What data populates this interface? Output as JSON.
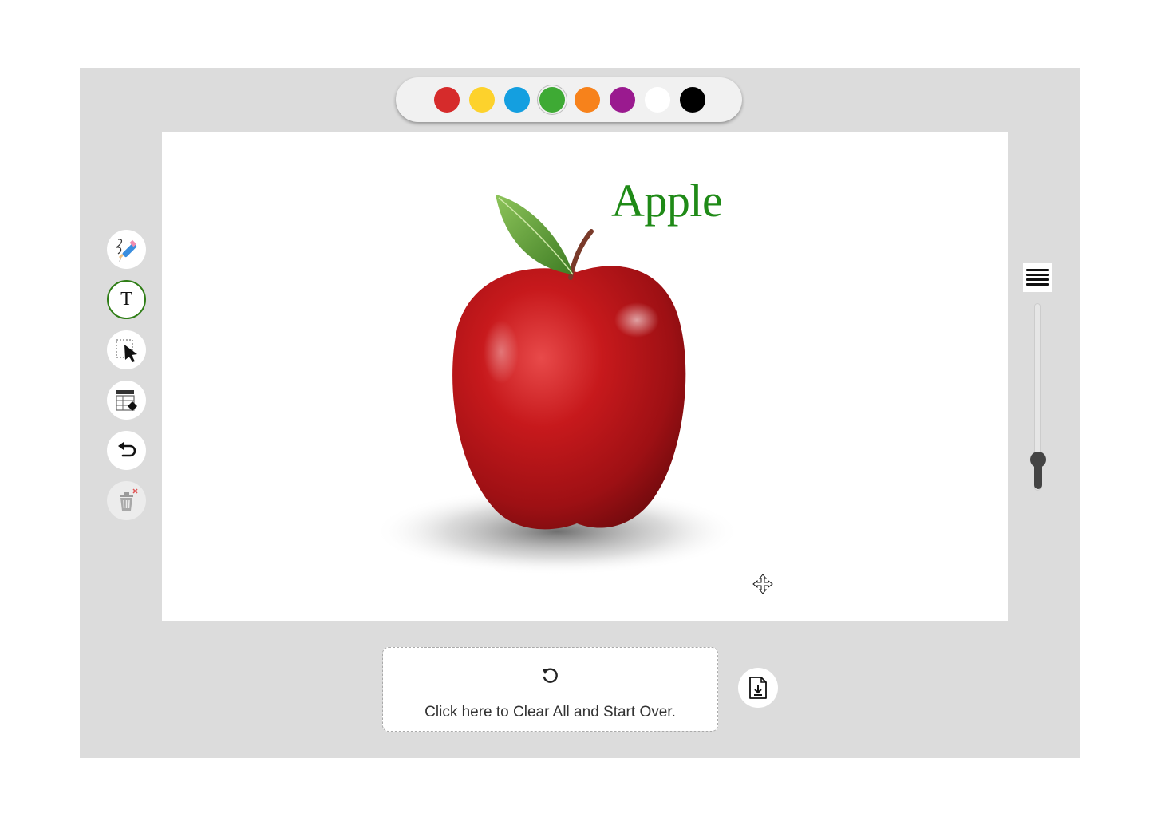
{
  "palette": {
    "colors": [
      "#d62b2b",
      "#fdd22c",
      "#149fe0",
      "#3eaa34",
      "#f7821b",
      "#9a1a8f",
      "#ffffff",
      "#000000"
    ],
    "selected_index": 3
  },
  "toolbar": {
    "tools": [
      "pencil-icon",
      "text-icon",
      "select-icon",
      "eraser-icon",
      "undo-icon",
      "trash-icon"
    ],
    "text_tool_glyph": "T",
    "active_tool": "text-icon"
  },
  "canvas": {
    "text_label": "Apple",
    "image": "apple-image",
    "cursor": "move-cursor-icon"
  },
  "slider": {
    "icon": "line-width-icon",
    "level": 0.1
  },
  "bottom": {
    "clear_text": "Click here to Clear All and Start Over.",
    "clear_icon": "refresh-icon",
    "download_icon": "download-file-icon"
  }
}
